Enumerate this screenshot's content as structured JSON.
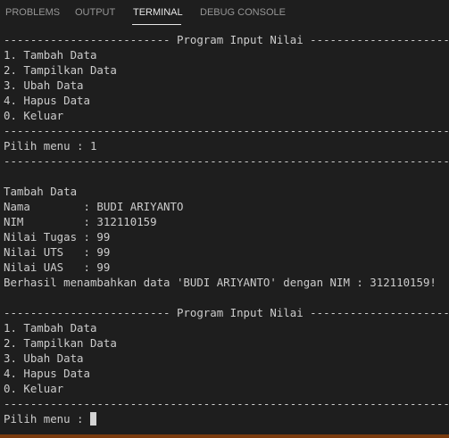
{
  "panel": {
    "tabs": [
      {
        "label": "PROBLEMS"
      },
      {
        "label": "OUTPUT"
      },
      {
        "label": "TERMINAL"
      },
      {
        "label": "DEBUG CONSOLE"
      }
    ],
    "active_tab": "TERMINAL"
  },
  "terminal": {
    "lines": [
      "------------------------- Program Input Nilai -------------------------",
      "1. Tambah Data",
      "2. Tampilkan Data",
      "3. Ubah Data",
      "4. Hapus Data",
      "0. Keluar",
      "-----------------------------------------------------------------------",
      "Pilih menu : 1",
      "-----------------------------------------------------------------------",
      "",
      "Tambah Data",
      "Nama        : BUDI ARIYANTO",
      "NIM         : 312110159",
      "Nilai Tugas : 99",
      "Nilai UTS   : 99",
      "Nilai UAS   : 99",
      "Berhasil menambahkan data 'BUDI ARIYANTO' dengan NIM : 312110159!",
      "",
      "------------------------- Program Input Nilai -------------------------",
      "1. Tambah Data",
      "2. Tampilkan Data",
      "3. Ubah Data",
      "4. Hapus Data",
      "0. Keluar",
      "-----------------------------------------------------------------------"
    ],
    "prompt": "Pilih menu : "
  },
  "colors": {
    "background": "#1e1e1e",
    "text": "#cccccc",
    "tab_inactive": "#969696",
    "tab_active": "#e7e7e7",
    "status_bar": "#7a3b0f"
  }
}
